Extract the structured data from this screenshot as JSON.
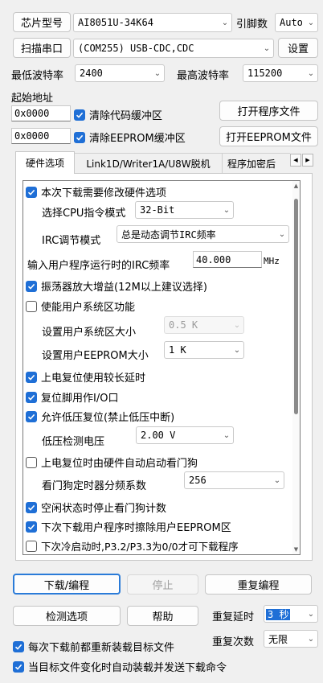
{
  "top": {
    "chip_button": "芯片型号",
    "chip_value": "AI8051U-34K64",
    "pins_label": "引脚数",
    "pins_value": "Auto",
    "scan_button": "扫描串口",
    "port_value": "(COM255) USB-CDC,CDC",
    "settings_button": "设置",
    "min_baud_label": "最低波特率",
    "min_baud_value": "2400",
    "max_baud_label": "最高波特率",
    "max_baud_value": "115200"
  },
  "address": {
    "title": "起始地址",
    "code_addr": "0x0000",
    "clear_code": "清除代码缓冲区",
    "open_program": "打开程序文件",
    "eeprom_addr": "0x0000",
    "clear_eeprom": "清除EEPROM缓冲区",
    "open_eeprom": "打开EEPROM文件"
  },
  "tabs": [
    "硬件选项",
    "Link1D/Writer1A/U8W脱机",
    "程序加密后"
  ],
  "hardware": {
    "modify_hw": "本次下载需要修改硬件选项",
    "cpu_mode_label": "选择CPU指令模式",
    "cpu_mode_value": "32-Bit",
    "irc_mode_label": "IRC调节模式",
    "irc_mode_value": "总是动态调节IRC频率",
    "irc_freq_label": "输入用户程序运行时的IRC频率",
    "irc_freq_value": "40.000",
    "irc_freq_unit": "MHz",
    "osc_gain": "振荡器放大增益(12M以上建议选择)",
    "user_sys_area": "使能用户系统区功能",
    "user_sys_size_label": "设置用户系统区大小",
    "user_sys_size_value": "0.5 K",
    "user_eeprom_size_label": "设置用户EEPROM大小",
    "user_eeprom_size_value": "1   K",
    "long_reset_delay": "上电复位使用较长延时",
    "reset_as_io": "复位脚用作I/O口",
    "lvd_reset": "允许低压复位(禁止低压中断)",
    "lvd_voltage_label": "低压检测电压",
    "lvd_voltage_value": "2.00 V",
    "wdt_hw_start": "上电复位时由硬件自动启动看门狗",
    "wdt_prescale_label": "看门狗定时器分频系数",
    "wdt_prescale_value": "256",
    "idle_stop_wdt": "空闲状态时停止看门狗计数",
    "erase_eeprom": "下次下载用户程序时擦除用户EEPROM区",
    "cold_start": "下次冷启动时,P3.2/P3.3为0/0才可下载程序"
  },
  "bottom": {
    "download_button": "下载/编程",
    "stop_button": "停止",
    "repeat_button": "重复编程",
    "detect_button": "检测选项",
    "help_button": "帮助",
    "repeat_delay_label": "重复延时",
    "repeat_delay_value": "3 秒",
    "repeat_count_label": "重复次数",
    "repeat_count_value": "无限",
    "reload_each": "每次下载前都重新装载目标文件",
    "auto_reload": "当目标文件变化时自动装载并发送下载命令"
  }
}
